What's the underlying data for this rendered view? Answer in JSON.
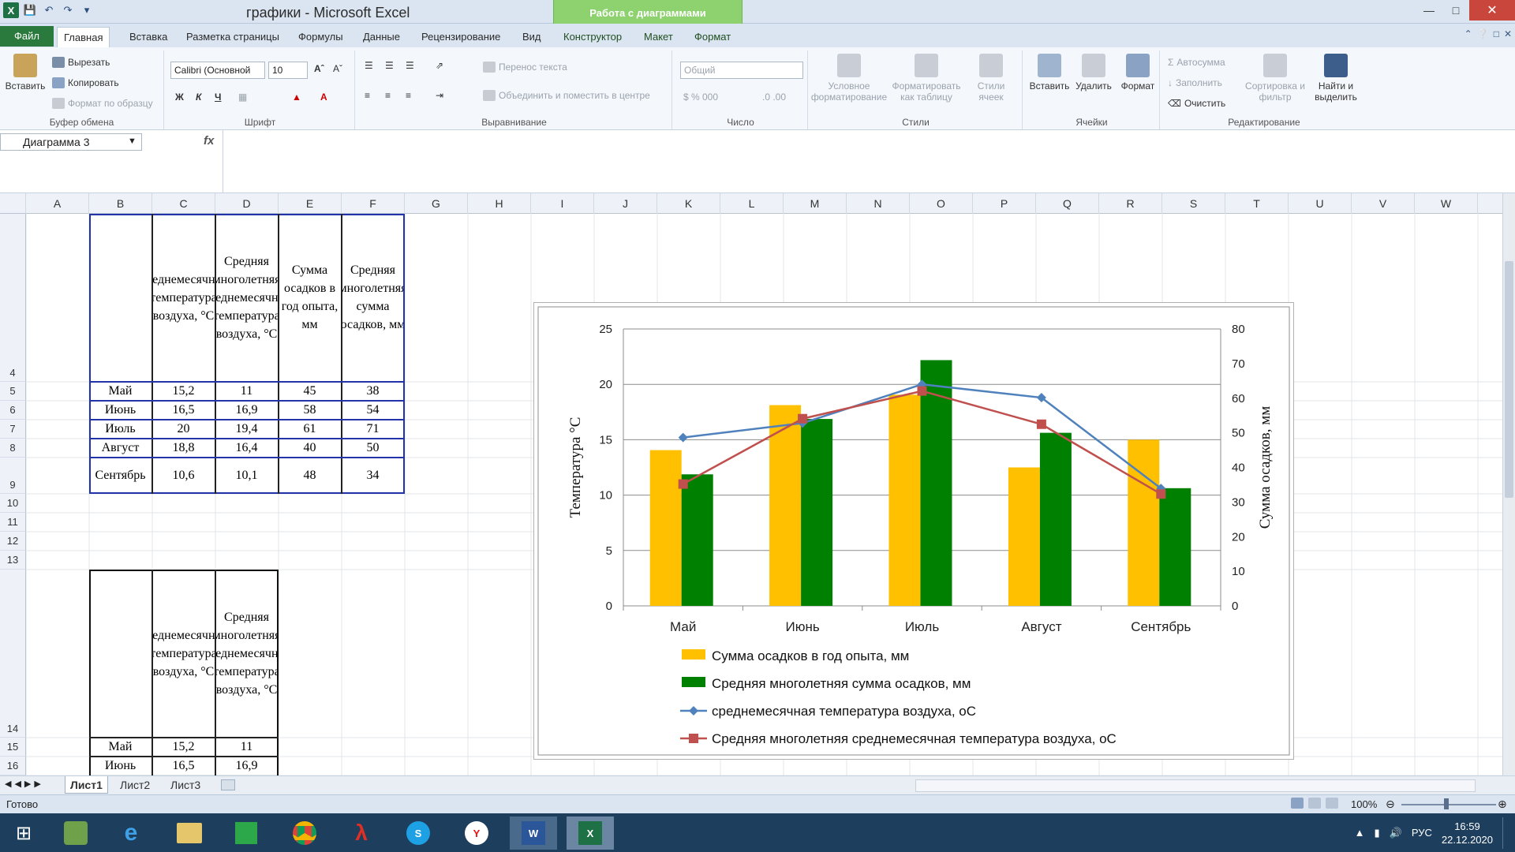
{
  "window": {
    "title": "графики  -  Microsoft Excel",
    "context_tools": "Работа с диаграммами"
  },
  "tabs": [
    {
      "label": "Файл"
    },
    {
      "label": "Главная"
    },
    {
      "label": "Вставка"
    },
    {
      "label": "Разметка страницы"
    },
    {
      "label": "Формулы"
    },
    {
      "label": "Данные"
    },
    {
      "label": "Рецензирование"
    },
    {
      "label": "Вид"
    },
    {
      "label": "Конструктор"
    },
    {
      "label": "Макет"
    },
    {
      "label": "Формат"
    }
  ],
  "ribbon": {
    "clipboard": {
      "label": "Буфер обмена",
      "paste": "Вставить",
      "cut": "Вырезать",
      "copy": "Копировать",
      "format_painter": "Формат по образцу"
    },
    "font": {
      "label": "Шрифт",
      "font_name": "Calibri (Основной",
      "font_size": "10",
      "bold": "Ж",
      "italic": "К",
      "underline": "Ч"
    },
    "alignment": {
      "label": "Выравнивание",
      "wrap": "Перенос текста",
      "merge": "Объединить и поместить в центре"
    },
    "number": {
      "label": "Число",
      "format": "Общий"
    },
    "styles": {
      "label": "Стили",
      "cond": "Условное форматирование",
      "table": "Форматировать как таблицу",
      "cell_styles": "Стили ячеек"
    },
    "cells": {
      "label": "Ячейки",
      "insert": "Вставить",
      "delete": "Удалить",
      "format": "Формат"
    },
    "editing": {
      "label": "Редактирование",
      "autosum": "Автосумма",
      "fill": "Заполнить",
      "clear": "Очистить",
      "sort": "Сортировка и фильтр",
      "find": "Найти и выделить"
    }
  },
  "formula_bar": {
    "name_box": "Диаграмма 3",
    "fx": "fx",
    "content": ""
  },
  "columns": [
    "A",
    "B",
    "C",
    "D",
    "E",
    "F",
    "G",
    "H",
    "I",
    "J",
    "K",
    "L",
    "M",
    "N",
    "O",
    "P",
    "Q",
    "R",
    "S",
    "T",
    "U",
    "V",
    "W"
  ],
  "rows": [
    "4",
    "5",
    "6",
    "7",
    "8",
    "9",
    "10",
    "11",
    "12",
    "13",
    "14",
    "15",
    "16"
  ],
  "table1": {
    "headers": [
      "",
      "среднемесячная температура воздуха, °С",
      "Средняя многолетняя среднемесячная температура воздуха, °С",
      "Сумма осадков в год опыта, мм",
      "Средняя многолетняя сумма осадков, мм"
    ],
    "rows": [
      [
        "Май",
        "15,2",
        "11",
        "45",
        "38"
      ],
      [
        "Июнь",
        "16,5",
        "16,9",
        "58",
        "54"
      ],
      [
        "Июль",
        "20",
        "19,4",
        "61",
        "71"
      ],
      [
        "Август",
        "18,8",
        "16,4",
        "40",
        "50"
      ],
      [
        "Сентябрь",
        "10,6",
        "10,1",
        "48",
        "34"
      ]
    ]
  },
  "table2": {
    "headers": [
      "",
      "среднемесячная температура воздуха, °С",
      "Средняя многолетняя среднемесячная температура воздуха, °С"
    ],
    "rows": [
      [
        "Май",
        "15,2",
        "11"
      ],
      [
        "Июнь",
        "16,5",
        "16,9"
      ]
    ]
  },
  "chart_data": {
    "type": "bar",
    "categories": [
      "Май",
      "Июнь",
      "Июль",
      "Август",
      "Сентябрь"
    ],
    "series": [
      {
        "name": "Сумма осадков в год опыта, мм",
        "type": "bar",
        "axis": "right",
        "color": "#FFC000",
        "values": [
          45,
          58,
          61,
          40,
          48
        ]
      },
      {
        "name": "Средняя многолетняя сумма осадков,  мм",
        "type": "bar",
        "axis": "right",
        "color": "#008000",
        "values": [
          38,
          54,
          71,
          50,
          34
        ]
      },
      {
        "name": "среднемесячная температура воздуха, оС",
        "type": "line",
        "axis": "left",
        "color": "#4F81BD",
        "marker": "diamond",
        "values": [
          15.2,
          16.5,
          20,
          18.8,
          10.6
        ]
      },
      {
        "name": "Средняя многолетняя среднемесячная температура воздуха,  оС",
        "type": "line",
        "axis": "left",
        "color": "#C0504D",
        "marker": "square",
        "values": [
          11,
          16.9,
          19.4,
          16.4,
          10.1
        ]
      }
    ],
    "ylabel": "Температура °С",
    "y2label": "Сумма осадков, мм",
    "ylim": [
      0,
      25
    ],
    "yticks": [
      "0",
      "5",
      "10",
      "15",
      "20",
      "25"
    ],
    "y2lim": [
      0,
      80
    ],
    "y2ticks": [
      "0",
      "10",
      "20",
      "30",
      "40",
      "50",
      "60",
      "70",
      "80"
    ],
    "grid": true,
    "legend": "bottom"
  },
  "sheets": [
    "Лист1",
    "Лист2",
    "Лист3"
  ],
  "status": {
    "ready": "Готово",
    "zoom": "100%"
  },
  "tray": {
    "lang": "РУС",
    "time": "16:59",
    "date": "22.12.2020"
  }
}
